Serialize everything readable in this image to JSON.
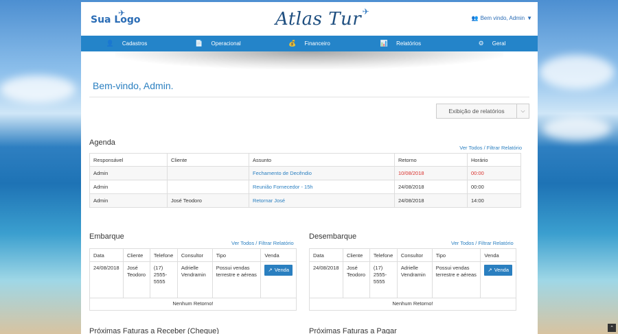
{
  "header": {
    "logo_left": "Sua Logo",
    "logo_center": "Atlas Tur",
    "user_greeting": "Bem vindo, Admin"
  },
  "nav": {
    "items": [
      {
        "label": "Cadastros",
        "icon": "user-icon"
      },
      {
        "label": "Operacional",
        "icon": "document-icon"
      },
      {
        "label": "Financeiro",
        "icon": "money-bag-icon"
      },
      {
        "label": "Relatórios",
        "icon": "chart-icon"
      },
      {
        "label": "Geral",
        "icon": "gears-icon"
      }
    ]
  },
  "main": {
    "welcome": "Bem-vindo, Admin.",
    "report_select": "Exibição de relatórios"
  },
  "agenda": {
    "title": "Agenda",
    "link": "Ver Todos / Filtrar Relatório",
    "columns": [
      "Responsável",
      "Cliente",
      "Assunto",
      "Retorno",
      "Horário"
    ],
    "rows": [
      {
        "responsavel": "Admin",
        "cliente": "",
        "assunto": "Fechamento de Decêndio",
        "retorno": "10/08/2018",
        "horario": "00:00"
      },
      {
        "responsavel": "Admin",
        "cliente": "",
        "assunto": "Reunião Fornecedor - 15h",
        "retorno": "24/08/2018",
        "horario": "00:00"
      },
      {
        "responsavel": "Admin",
        "cliente": "José Teodoro",
        "assunto": "Retornar José",
        "retorno": "24/08/2018",
        "horario": "14:00"
      }
    ]
  },
  "embarque": {
    "title": "Embarque",
    "link": "Ver Todos / Filtrar Relatório",
    "columns": [
      "Data",
      "Cliente",
      "Telefone",
      "Consultor",
      "Tipo",
      "Venda"
    ],
    "row": {
      "data": "24/08/2018",
      "cliente": "José Teodoro",
      "telefone": "(17) 2555-5555",
      "consultor": "Adrielle Vendramin",
      "tipo": "Possui vendas terrestre e aéreas",
      "venda": "Venda"
    },
    "empty": "Nenhum Retorno!"
  },
  "desembarque": {
    "title": "Desembarque",
    "link": "Ver Todos / Filtrar Relatório",
    "columns": [
      "Data",
      "Cliente",
      "Telefone",
      "Consultor",
      "Tipo",
      "Venda"
    ],
    "row": {
      "data": "24/08/2018",
      "cliente": "José Teodoro",
      "telefone": "(17) 2555-5555",
      "consultor": "Adrielle Vendramin",
      "tipo": "Possui vendas terrestre e aéreas",
      "venda": "Venda"
    },
    "empty": "Nenhum Retorno!"
  },
  "bottom": {
    "left_title": "Próximas Faturas a Receber (Cheque)",
    "right_title": "Próximas Faturas a Pagar"
  },
  "colors": {
    "accent": "#2484c9",
    "link": "#2a7fc0",
    "alert": "#d9302c"
  }
}
